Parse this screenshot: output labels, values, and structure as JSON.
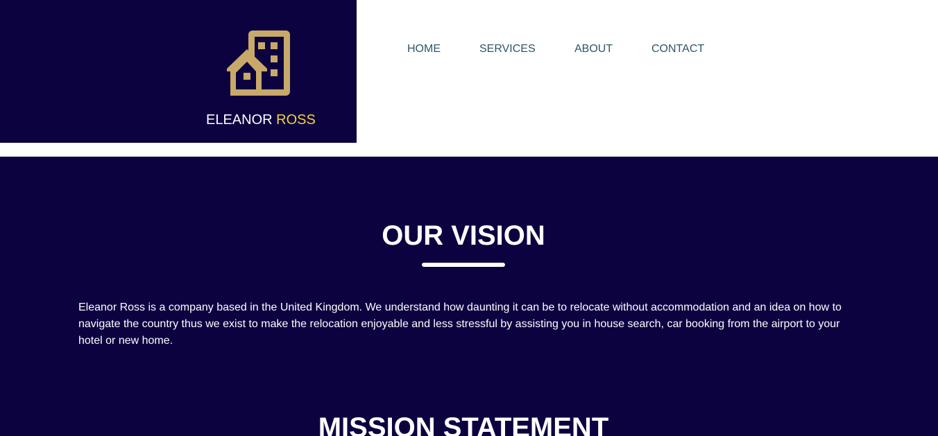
{
  "brand": {
    "name_first": "ELEANOR",
    "name_second": "ROSS",
    "logo_icon": "building-home-icon",
    "colors": {
      "dark_navy": "#0d0240",
      "gold_icon": "#c9a96a",
      "accent_yellow": "#f2d33c",
      "nav_text": "#2c5664"
    }
  },
  "nav": {
    "items": [
      {
        "label": "HOME"
      },
      {
        "label": "SERVICES"
      },
      {
        "label": "ABOUT"
      },
      {
        "label": "CONTACT"
      }
    ]
  },
  "vision": {
    "title": "OUR VISION",
    "body": "Eleanor Ross is a company based in the United Kingdom. We understand how daunting it can be to relocate without accommodation and an idea on how to navigate the country thus we exist to make the relocation enjoyable and less stressful by assisting you in house search, car booking from the airport to your hotel or new home."
  },
  "mission": {
    "title": "MISSION STATEMENT"
  }
}
